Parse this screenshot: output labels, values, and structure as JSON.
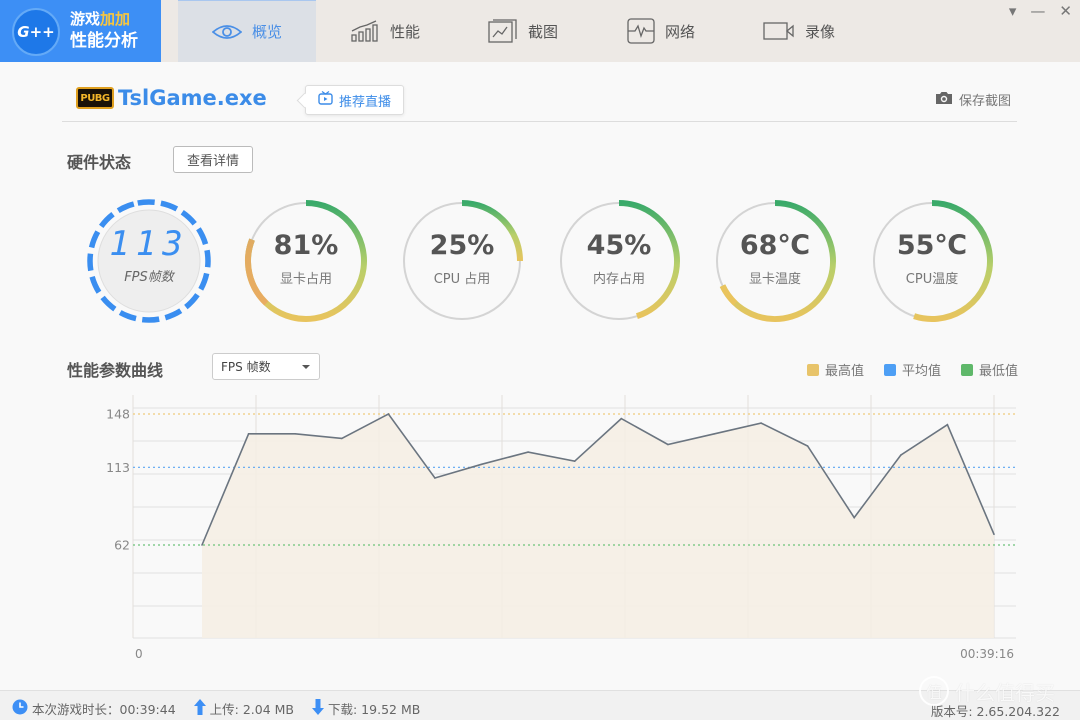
{
  "brand": {
    "logo_text": "G++",
    "line1_prefix": "游戏",
    "line1_highlight": "加加",
    "line2": "性能分析"
  },
  "tabs": [
    {
      "label": "概览",
      "icon": "eye-icon",
      "active": true
    },
    {
      "label": "性能",
      "icon": "performance-chart-icon",
      "active": false
    },
    {
      "label": "截图",
      "icon": "screenshot-icon",
      "active": false
    },
    {
      "label": "网络",
      "icon": "network-pulse-icon",
      "active": false
    },
    {
      "label": "录像",
      "icon": "video-camera-icon",
      "active": false
    }
  ],
  "window_controls": {
    "menu": "▾",
    "minimize": "—",
    "close": "✕"
  },
  "game": {
    "icon_text": "PUBG",
    "name": "TslGame.exe",
    "live_button": "推荐直播",
    "save_screenshot": "保存截图"
  },
  "hardware": {
    "title": "硬件状态",
    "details_button": "查看详情",
    "gauges": [
      {
        "id": "fps",
        "value": "113",
        "label": "FPS帧数"
      },
      {
        "id": "gpu-usage",
        "value": "81%",
        "label": "显卡占用",
        "fraction": 0.81
      },
      {
        "id": "cpu-usage",
        "value": "25%",
        "label": "CPU 占用",
        "fraction": 0.25
      },
      {
        "id": "memory-usage",
        "value": "45%",
        "label": "内存占用",
        "fraction": 0.45
      },
      {
        "id": "gpu-temp",
        "value": "68℃",
        "label": "显卡温度",
        "fraction": 0.68
      },
      {
        "id": "cpu-temp",
        "value": "55℃",
        "label": "CPU温度",
        "fraction": 0.55
      }
    ]
  },
  "curve": {
    "title": "性能参数曲线",
    "select_value": "FPS 帧数",
    "legend": [
      {
        "label": "最高值",
        "color": "#e8c46a"
      },
      {
        "label": "平均值",
        "color": "#4e9ff5"
      },
      {
        "label": "最低值",
        "color": "#5fb86a"
      }
    ]
  },
  "chart_data": {
    "type": "area",
    "title": "",
    "xlabel": "",
    "ylabel": "",
    "x_tick_labels": [
      "0",
      "00:39:16"
    ],
    "y_tick_labels": [
      "148",
      "113",
      "62"
    ],
    "ylim": [
      0,
      155
    ],
    "grid": true,
    "legend_position": "top-right",
    "series": [
      {
        "name": "FPS 帧数",
        "values": [
          62,
          135,
          135,
          132,
          148,
          106,
          115,
          123,
          117,
          145,
          128,
          135,
          142,
          127,
          80,
          121,
          141,
          69
        ]
      }
    ],
    "reference_lines": [
      {
        "name": "最高值",
        "value": 148,
        "color": "#f0cc7c"
      },
      {
        "name": "平均值",
        "value": 113,
        "color": "#5aa5f2"
      },
      {
        "name": "最低值",
        "value": 62,
        "color": "#6cc27a"
      }
    ],
    "line_color": "#6b7580",
    "fill_color": "#f6efe4"
  },
  "status": {
    "play_time": "本次游戏时长：00:39:44",
    "upload": "上传: 2.04 MB",
    "download": "下载: 19.52 MB",
    "version": "版本号: 2.65.204.322"
  },
  "watermark": {
    "badge": "值",
    "text": "什么值得买"
  }
}
